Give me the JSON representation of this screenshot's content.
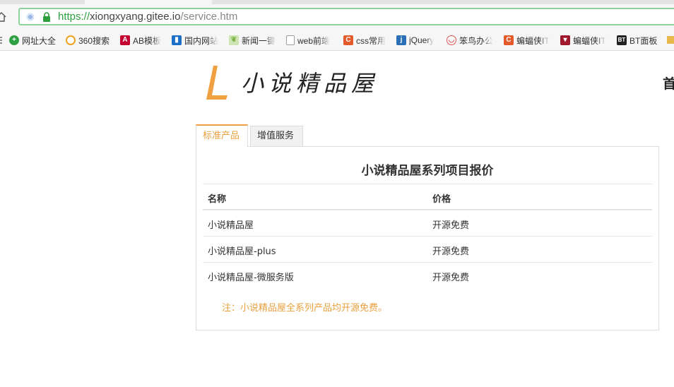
{
  "browser": {
    "url_scheme": "https://",
    "url_host": "xiongxyang.gitee.io",
    "url_path": "/service.htm",
    "bookmarks": [
      {
        "label": "网址大全",
        "icon": "plus-circle-icon",
        "color": "#2ea043"
      },
      {
        "label": "360搜索",
        "icon": "search-q-icon",
        "color": "#f0a020"
      },
      {
        "label": "AB模板",
        "icon": "angular-icon",
        "color": "#c3002f"
      },
      {
        "label": "国内网站",
        "icon": "bookmark-page-icon",
        "color": "#1e6fc8"
      },
      {
        "label": "新闻一键",
        "icon": "leaf-icon",
        "color": "#7cb342"
      },
      {
        "label": "web前端",
        "icon": "document-icon",
        "color": "#9e9e9e"
      },
      {
        "label": "css常用",
        "icon": "c-icon",
        "color": "#e55a2b"
      },
      {
        "label": "jQuery",
        "icon": "jquery-icon",
        "color": "#2a6eb5"
      },
      {
        "label": "笨鸟办公",
        "icon": "owl-icon",
        "color": "#d9534f"
      },
      {
        "label": "蝙蝠侠IT",
        "icon": "c-icon",
        "color": "#e55a2b"
      },
      {
        "label": "蝙蝠侠IT",
        "icon": "batman-icon",
        "color": "#a0182c"
      },
      {
        "label": "BT面板",
        "icon": "bt-icon",
        "color": "#222222"
      }
    ]
  },
  "header": {
    "logo_text": "小说精品屋",
    "nav_first": "首"
  },
  "tabs": [
    {
      "label": "标准产品",
      "active": true
    },
    {
      "label": "增值服务",
      "active": false
    }
  ],
  "pricing": {
    "title": "小说精品屋系列项目报价",
    "columns": [
      "名称",
      "价格"
    ],
    "rows": [
      {
        "name": "小说精品屋",
        "price": "开源免费"
      },
      {
        "name": "小说精品屋-plus",
        "price": "开源免费"
      },
      {
        "name": "小说精品屋-微服务版",
        "price": "开源免费"
      }
    ],
    "note": "注：小说精品屋全系列产品均开源免费。"
  },
  "colors": {
    "accent": "#f0a040",
    "address_border": "#8fd19a",
    "url_scheme": "#2e9f3e"
  }
}
